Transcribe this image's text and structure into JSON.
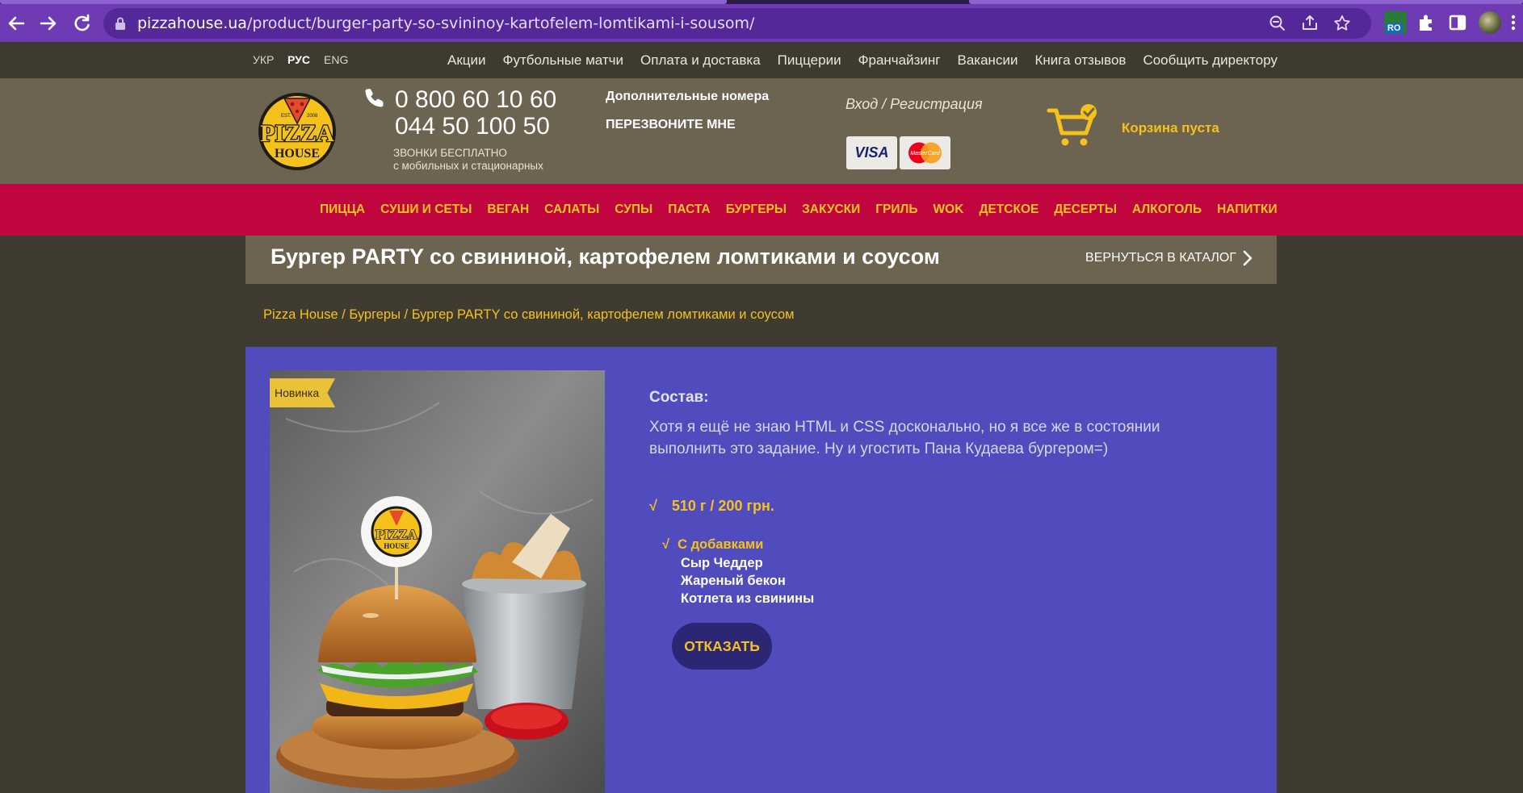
{
  "browser": {
    "url_host": "pizzahouse.ua",
    "url_path": "/product/burger-party-so-svininoy-kartofelem-lomtikami-i-sousom/",
    "extension_badge": "RO"
  },
  "topbar": {
    "languages": [
      "УКР",
      "РУС",
      "ENG"
    ],
    "active_language": "РУС",
    "links": [
      "Акции",
      "Футбольные матчи",
      "Оплата и доставка",
      "Пиццерии",
      "Франчайзинг",
      "Вакансии",
      "Книга отзывов",
      "Сообщить директору"
    ]
  },
  "header": {
    "logo": {
      "est": "EST.",
      "year": "2008",
      "line1": "PIZZA",
      "line2": "HOUSE"
    },
    "phone1": "0 800 60 10 60",
    "phone2": "044 50 100 50",
    "free_calls_line1": "ЗВОНКИ БЕСПЛАТНО",
    "free_calls_line2": "с мобильных и стационарных",
    "extra_numbers": "Дополнительные номера",
    "callback": "ПЕРЕЗВОНИТЕ МНЕ",
    "login": "Вход / Регистрация",
    "cards": [
      "VISA",
      "MasterCard"
    ],
    "cart_status": "Корзина пуста"
  },
  "categories": [
    "ПИЦЦА",
    "СУШИ И СЕТЫ",
    "ВЕГАН",
    "САЛАТЫ",
    "СУПЫ",
    "ПАСТА",
    "БУРГЕРЫ",
    "ЗАКУСКИ",
    "ГРИЛЬ",
    "WOK",
    "ДЕТСКОЕ",
    "ДЕСЕРТЫ",
    "АЛКОГОЛЬ",
    "НАПИТКИ"
  ],
  "page": {
    "title": "Бургер PARTY со свининой, картофелем ломтиками и соусом",
    "back_to_catalog": "ВЕРНУТЬСЯ В КАТАЛОГ",
    "breadcrumb": "Pizza House / Бургеры / Бургер PARTY со свининой, картофелем ломтиками и соусом"
  },
  "product": {
    "badge": "Новинка",
    "composition_label": "Состав:",
    "description": "Хотя я ещё не знаю HTML и CSS досконально, но я все же в состоянии выполнить это задание. Ну и угостить Пана Кудаева бургером=)",
    "check_mark": "√",
    "weight_price": "510 г / 200 грн.",
    "addons_title": "С добавками",
    "addons": [
      "Сыр Чеддер",
      "Жареный бекон",
      "Котлета из свинины"
    ],
    "refuse_button": "ОТКАЗАТЬ"
  },
  "colors": {
    "chrome": "#6e3bb5",
    "accent_yellow": "#f4c21b",
    "category_bar": "#c1053e",
    "panel": "#514cbe",
    "header": "#6c6350"
  }
}
